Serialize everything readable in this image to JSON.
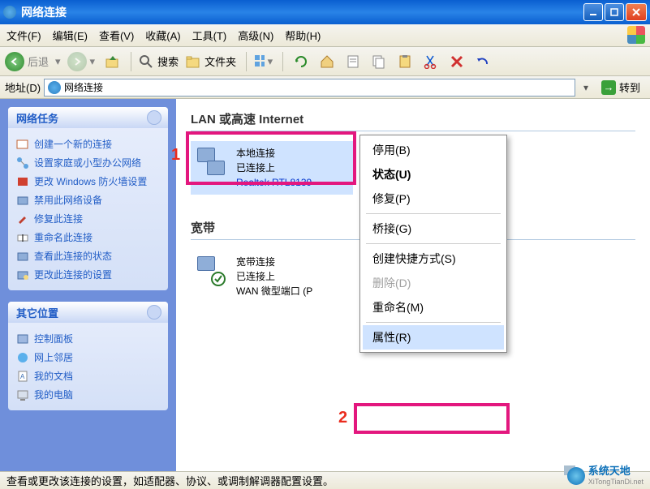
{
  "titlebar": {
    "title": "网络连接"
  },
  "menus": {
    "file": "文件(F)",
    "edit": "编辑(E)",
    "view": "查看(V)",
    "favorites": "收藏(A)",
    "tools": "工具(T)",
    "advanced": "高级(N)",
    "help": "帮助(H)"
  },
  "toolbar": {
    "back": "后退",
    "search": "搜索",
    "folders": "文件夹"
  },
  "addressbar": {
    "label": "地址(D)",
    "value": "网络连接",
    "go": "转到"
  },
  "sidebar": {
    "tasks_header": "网络任务",
    "tasks": [
      "创建一个新的连接",
      "设置家庭或小型办公网络",
      "更改 Windows 防火墙设置",
      "禁用此网络设备",
      "修复此连接",
      "重命名此连接",
      "查看此连接的状态",
      "更改此连接的设置"
    ],
    "places_header": "其它位置",
    "places": [
      "控制面板",
      "网上邻居",
      "我的文档",
      "我的电脑"
    ]
  },
  "content": {
    "section_lan": "LAN 或高速 Internet",
    "lan_conn": {
      "name": "本地连接",
      "status": "已连接上",
      "device": "Realtek RTL8139"
    },
    "section_broadband": "宽带",
    "bb_conn": {
      "name": "宽带连接",
      "status": "已连接上",
      "device": "WAN 微型端口 (P"
    }
  },
  "contextmenu": {
    "disable": "停用(B)",
    "status": "状态(U)",
    "repair": "修复(P)",
    "bridge": "桥接(G)",
    "shortcut": "创建快捷方式(S)",
    "delete": "删除(D)",
    "rename": "重命名(M)",
    "properties": "属性(R)"
  },
  "annotations": {
    "one": "1",
    "two": "2"
  },
  "statusbar": {
    "text": "查看或更改该连接的设置，如适配器、协议、或调制解调器配置设置。"
  },
  "watermark": {
    "brand": "系统天地",
    "url": "XiTongTianDi.net"
  }
}
